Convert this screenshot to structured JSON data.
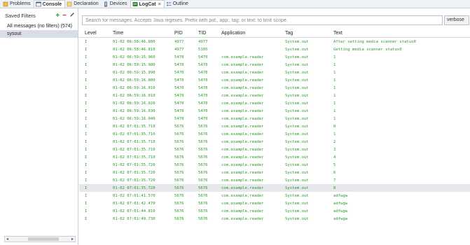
{
  "tabs": [
    {
      "label": "Problems",
      "icon": "problems-icon"
    },
    {
      "label": "Console",
      "icon": "console-icon"
    },
    {
      "label": "Declaration",
      "icon": "declaration-icon"
    },
    {
      "label": "Devices",
      "icon": "devices-icon"
    },
    {
      "label": "LogCat",
      "icon": "logcat-icon"
    },
    {
      "label": "Outline",
      "icon": "outline-icon"
    }
  ],
  "filters": {
    "title": "Saved Filters",
    "items": [
      "All messages (no filters) (574)",
      "sysout"
    ]
  },
  "search": {
    "placeholder": "Search for messages. Accepts Java regexes. Prefix with pid:, app:, tag: or text: to limit scope.",
    "level": "verbose"
  },
  "columns": [
    "Level",
    "Time",
    "PID",
    "TID",
    "Application",
    "Tag",
    "Text"
  ],
  "rows": [
    [
      "I",
      "01-02 06:58:46.800",
      "4977",
      "4977",
      "",
      "System.out",
      "After setting media scanner status0"
    ],
    [
      "I",
      "01-02 06:58:46.810",
      "4977",
      "5105",
      "",
      "System.out",
      "Getting media scanner status0"
    ],
    [
      "I",
      "01-02 06:59:15.960",
      "5470",
      "5470",
      "com.example.reader",
      "System.out",
      "1"
    ],
    [
      "I",
      "01-02 06:59:15.980",
      "5470",
      "5470",
      "com.example.reader",
      "System.out",
      "1"
    ],
    [
      "I",
      "01-02 06:59:15.990",
      "5470",
      "5470",
      "com.example.reader",
      "System.out",
      "1"
    ],
    [
      "I",
      "01-02 06:59:16.000",
      "5470",
      "5470",
      "com.example.reader",
      "System.out",
      "1"
    ],
    [
      "I",
      "01-02 06:59:16.010",
      "5470",
      "5470",
      "com.example.reader",
      "System.out",
      "1"
    ],
    [
      "I",
      "01-02 06:59:16.010",
      "5470",
      "5470",
      "com.example.reader",
      "System.out",
      "1"
    ],
    [
      "I",
      "01-02 06:59:16.020",
      "5470",
      "5470",
      "com.example.reader",
      "System.out",
      "1"
    ],
    [
      "I",
      "01-02 06:59:16.030",
      "5470",
      "5470",
      "com.example.reader",
      "System.out",
      "1"
    ],
    [
      "I",
      "01-02 06:59:16.040",
      "5470",
      "5470",
      "com.example.reader",
      "System.out",
      "1"
    ],
    [
      "I",
      "01-02 07:01:35.710",
      "5676",
      "5676",
      "com.example.reader",
      "System.out",
      "0"
    ],
    [
      "I",
      "01-02 07:01:35.710",
      "5676",
      "5676",
      "com.example.reader",
      "System.out",
      "1"
    ],
    [
      "I",
      "01-02 07:01:35.710",
      "5676",
      "5676",
      "com.example.reader",
      "System.out",
      "2"
    ],
    [
      "I",
      "01-02 07:01:35.710",
      "5676",
      "5676",
      "com.example.reader",
      "System.out",
      "3"
    ],
    [
      "I",
      "01-02 07:01:35.710",
      "5676",
      "5676",
      "com.example.reader",
      "System.out",
      "4"
    ],
    [
      "I",
      "01-02 07:01:35.720",
      "5676",
      "5676",
      "com.example.reader",
      "System.out",
      "5"
    ],
    [
      "I",
      "01-02 07:01:35.720",
      "5676",
      "5676",
      "com.example.reader",
      "System.out",
      "6"
    ],
    [
      "I",
      "01-02 07:01:35.720",
      "5676",
      "5676",
      "com.example.reader",
      "System.out",
      "7"
    ],
    [
      "I",
      "01-02 07:01:35.720",
      "5676",
      "5676",
      "com.example.reader",
      "System.out",
      "8"
    ],
    [
      "I",
      "01-02 07:01:41.570",
      "5676",
      "5676",
      "com.example.reader",
      "System.out",
      "adfwgw"
    ],
    [
      "I",
      "01-02 07:01:42.470",
      "5676",
      "5676",
      "com.example.reader",
      "System.out",
      "adfwgw"
    ],
    [
      "I",
      "01-02 07:01:44.810",
      "5676",
      "5676",
      "com.example.reader",
      "System.out",
      "adfwgw"
    ],
    [
      "I",
      "01-02 07:01:49.730",
      "5676",
      "5676",
      "com.example.reader",
      "System.out",
      "adfwgw"
    ]
  ],
  "selected_row": 19,
  "colors": {
    "log_text": "#2a9a2a",
    "selection": "#e6e8ec",
    "add_filter": "#2e9e2e",
    "remove_filter": "#d32f2f"
  }
}
